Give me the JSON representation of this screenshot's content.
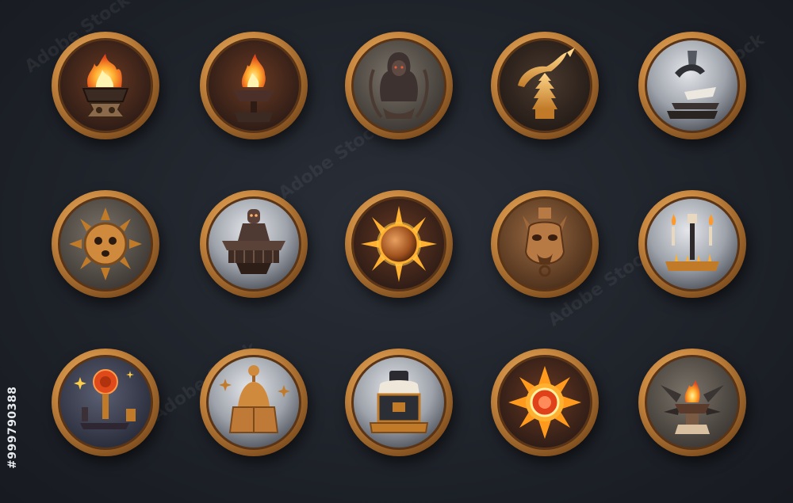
{
  "watermark": {
    "brand_text": "Adobe Stock",
    "asset_id": "#999790388"
  },
  "colors": {
    "background": "#1e2229",
    "rim_gold": "#c8873f",
    "rim_light": "#e6a860",
    "flame": "#ff8a1c",
    "ember": "#ffcf4a"
  },
  "icons": [
    {
      "row": 1,
      "col": 1,
      "name": "flaming-brazier-icon",
      "style": "dark-fire"
    },
    {
      "row": 1,
      "col": 2,
      "name": "torch-bowl-icon",
      "style": "dark-fire"
    },
    {
      "row": 1,
      "col": 3,
      "name": "hooded-monk-icon",
      "style": "stone"
    },
    {
      "row": 1,
      "col": 4,
      "name": "golden-serpent-totem-icon",
      "style": "dark-gold"
    },
    {
      "row": 1,
      "col": 5,
      "name": "anvil-hammer-icon",
      "style": "silver"
    },
    {
      "row": 2,
      "col": 1,
      "name": "sun-mask-icon",
      "style": "stone"
    },
    {
      "row": 2,
      "col": 2,
      "name": "robot-throne-icon",
      "style": "silver"
    },
    {
      "row": 2,
      "col": 3,
      "name": "blazing-sun-icon",
      "style": "dark-fire"
    },
    {
      "row": 2,
      "col": 4,
      "name": "gargoyle-head-icon",
      "style": "bronze"
    },
    {
      "row": 2,
      "col": 5,
      "name": "candle-altar-icon",
      "style": "silver"
    },
    {
      "row": 3,
      "col": 1,
      "name": "orb-pedestal-icon",
      "style": "night"
    },
    {
      "row": 3,
      "col": 2,
      "name": "golden-dome-icon",
      "style": "silver"
    },
    {
      "row": 3,
      "col": 3,
      "name": "treasure-chest-icon",
      "style": "silver"
    },
    {
      "row": 3,
      "col": 4,
      "name": "radiant-sun-orb-icon",
      "style": "dark-fire"
    },
    {
      "row": 3,
      "col": 5,
      "name": "forge-fire-icon",
      "style": "stone"
    }
  ]
}
